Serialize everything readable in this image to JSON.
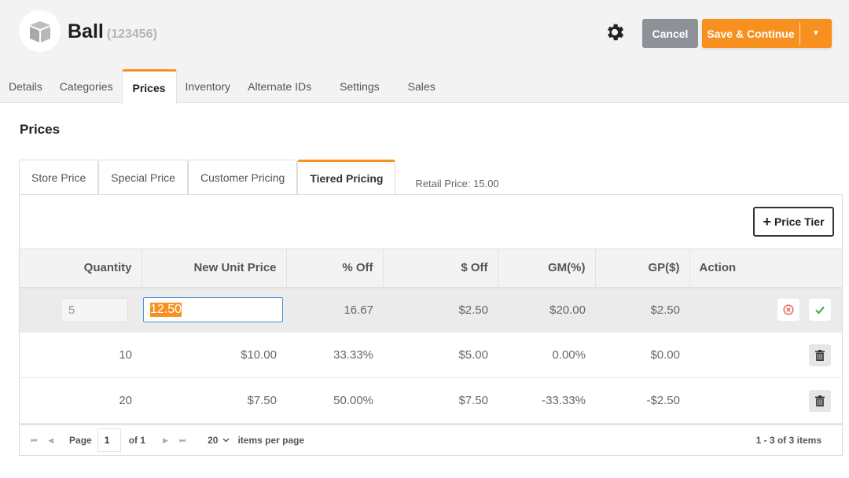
{
  "header": {
    "product_name": "Ball",
    "product_code": "(123456)",
    "cancel_label": "Cancel",
    "save_label": "Save & Continue",
    "accent": "#f7901e"
  },
  "tabs": [
    {
      "label": "Details",
      "active": false
    },
    {
      "label": "Categories",
      "active": false
    },
    {
      "label": "Prices",
      "active": true
    },
    {
      "label": "Inventory",
      "active": false
    },
    {
      "label": "Alternate IDs",
      "active": false
    },
    {
      "label": "Settings",
      "active": false
    },
    {
      "label": "Sales",
      "active": false
    }
  ],
  "section_title": "Prices",
  "subtabs": [
    {
      "label": "Store Price",
      "active": false
    },
    {
      "label": "Special Price",
      "active": false
    },
    {
      "label": "Customer Pricing",
      "active": false
    },
    {
      "label": "Tiered Pricing",
      "active": true
    }
  ],
  "retail_price": "Retail Price: 15.00",
  "add_tier_label": "Price Tier",
  "table": {
    "columns": [
      "Quantity",
      "New Unit Price",
      "% Off",
      "$ Off",
      "GM(%)",
      "GP($)",
      "Action"
    ],
    "editing_row": {
      "quantity": "5",
      "new_unit_price": "12.50",
      "pct_off": "16.67",
      "dollar_off": "$2.50",
      "gm": "$20.00",
      "gp": "$2.50"
    },
    "rows": [
      {
        "quantity": "10",
        "new_unit_price": "$10.00",
        "pct_off": "33.33%",
        "dollar_off": "$5.00",
        "gm": "0.00%",
        "gp": "$0.00"
      },
      {
        "quantity": "20",
        "new_unit_price": "$7.50",
        "pct_off": "50.00%",
        "dollar_off": "$7.50",
        "gm": "-33.33%",
        "gp": "-$2.50"
      }
    ]
  },
  "pager": {
    "page_label": "Page",
    "page": "1",
    "of_label": "of 1",
    "page_size": "20",
    "ipp_label": "items per page",
    "info": "1 - 3 of 3 items"
  }
}
